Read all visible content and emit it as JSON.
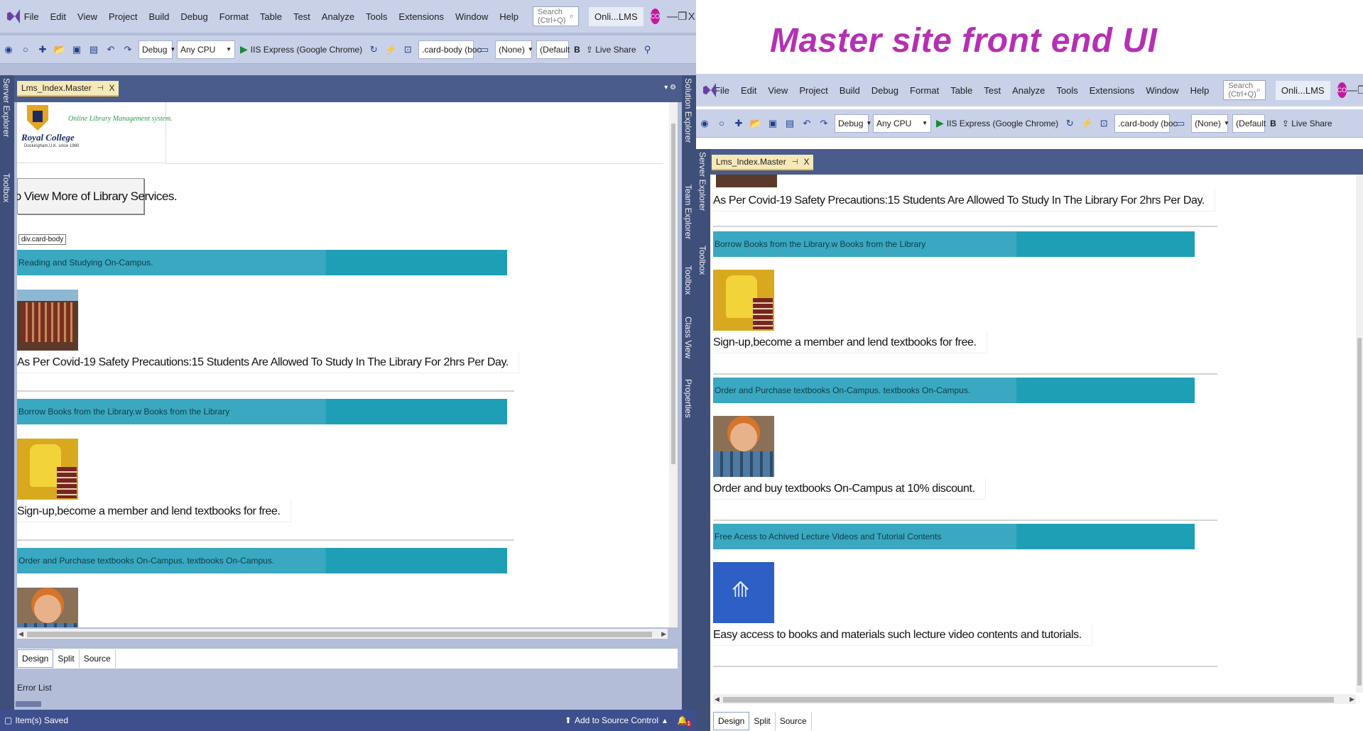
{
  "overlay_title": "Master site front end UI",
  "menu": [
    "File",
    "Edit",
    "View",
    "Project",
    "Build",
    "Debug",
    "Format",
    "Table",
    "Test",
    "Analyze",
    "Tools",
    "Extensions",
    "Window",
    "Help"
  ],
  "search_placeholder": "Search (Ctrl+Q)",
  "solution_name": "Onli...LMS",
  "avatar_initials": "CO",
  "window_controls": {
    "minimize": "—",
    "restore": "❐",
    "close": "X"
  },
  "toolbar": {
    "config": "Debug",
    "platform": "Any CPU",
    "run_target": "IIS Express (Google Chrome)",
    "element_selector": ".card-body (boc",
    "style_none": "(None)",
    "font_default": "(Default",
    "bold": "B",
    "live_share": "Live Share"
  },
  "doc_tab": {
    "label": "Lms_Index.Master",
    "pin": "⊣",
    "close": "X"
  },
  "tool_windows_left": [
    "Server Explorer",
    "Toolbox"
  ],
  "tool_windows_right": [
    "Solution Explorer",
    "Team Explorer",
    "Toolbox",
    "Class View",
    "Properties"
  ],
  "header": {
    "college_name": "Royal College",
    "college_sub": "Dockingham,U.K. since 1960",
    "tagline": "Online Library Management system."
  },
  "view_more_button": "Click to View More of Library Services.",
  "card_body_tag": "div.card-body",
  "sections": [
    {
      "title": "Reading and Studying On-Campus.",
      "text": "As Per Covid-19 Safety Precautions:15 Students Are Allowed To Study In The Library For 2hrs Per Day.",
      "image": "library-photo"
    },
    {
      "title": "Borrow Books from the Library.w Books from the Library",
      "text": "Sign-up,become a member and lend textbooks for free.",
      "image": "bart-books-photo"
    },
    {
      "title": "Order and Purchase textbooks On-Campus. textbooks On-Campus.",
      "text": "Order and buy textbooks On-Campus at 10% discount.",
      "image": "bookstore-kid-photo"
    },
    {
      "title": "Free Acess to Achived Lecture Videos and Tutorial Contents",
      "text": "Easy access to books and materials such lecture video contents and tutorials.",
      "image": "video-thumbnail"
    }
  ],
  "view_tabs": [
    "Design",
    "Split",
    "Source"
  ],
  "error_list": "Error List",
  "status": {
    "saved": "Item(s) Saved",
    "source_control": "Add to Source Control",
    "notification_count": "1"
  }
}
